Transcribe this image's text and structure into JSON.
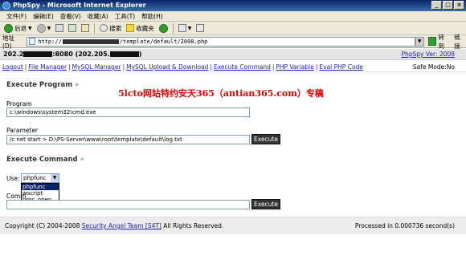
{
  "window": {
    "title": "PhpSpy - Microsoft Internet Explorer",
    "controls": [
      "_",
      "□",
      "×"
    ]
  },
  "menu": [
    "文件(F)",
    "编辑(E)",
    "查看(V)",
    "收藏(A)",
    "工具(T)",
    "帮助(H)"
  ],
  "toolbar": {
    "back_label": "后退",
    "search_label": "搜索",
    "favorites_label": "收藏夹"
  },
  "address": {
    "label": "地址(D)",
    "url_prefix": "http://",
    "url_suffix": "/template/default/2008.php",
    "go_label": "转到",
    "links_label": "链接"
  },
  "header": {
    "host_prefix": "202.2",
    "host_mid": ":8080 (202.205.",
    "host_suffix": ")",
    "version": "PhpSpy Ver: 2008"
  },
  "nav": {
    "links": [
      "Logout",
      "File Manager",
      "MySQL Manager",
      "MySQL Upload & Download",
      "Execute Command",
      "PHP Variable",
      "Eval PHP Code"
    ],
    "safe_mode": "Safe Mode:No"
  },
  "execute_program": {
    "title": "Execute Program",
    "raquo": "»",
    "program_label": "Program",
    "program_value": "c:\\windows\\system32\\cmd.exe",
    "parameter_label": "Parameter",
    "parameter_value": "/c net start > D:\\PS-Server\\www\\root\\template\\default\\log.txt",
    "button": "Execute"
  },
  "watermark": "5lcto网站特约安天365（antian365.com）专稿",
  "execute_command": {
    "title": "Execute Command",
    "raquo": "»",
    "use_label": "Use:",
    "selected": "phpfunc",
    "options": [
      "phpfunc",
      "wscript",
      "proc_open"
    ],
    "command_label": "Comm",
    "command_value": "",
    "button": "Execute"
  },
  "footer": {
    "copyright_prefix": "Copyright (C) 2004-2008 ",
    "team_link": "Security Angel Team [S4T]",
    "copyright_suffix": " All Rights Reserved.",
    "processed": "Processed in 0.000736 second(s)"
  }
}
